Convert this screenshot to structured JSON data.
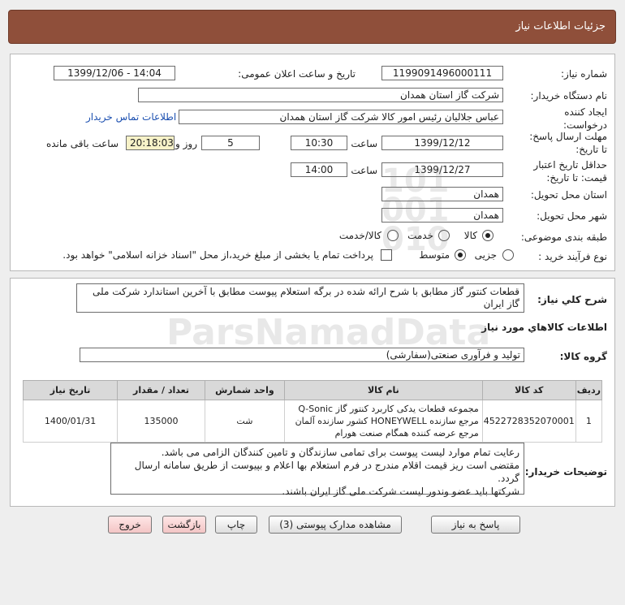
{
  "header": {
    "title": "جزئیات اطلاعات نیاز"
  },
  "fields": {
    "need_number_label": "شماره نیاز:",
    "need_number": "1199091496000111",
    "announce_label": "تاریخ و ساعت اعلان عمومی:",
    "announce_value": "1399/12/06 - 14:04",
    "buyer_label": "نام دستگاه خریدار:",
    "buyer_value": "شرکت گاز استان همدان",
    "creator_label": "ایجاد کننده درخواست:",
    "creator_value": "عباس جلالیان رئیس امور کالا شرکت گاز استان همدان",
    "contact_link": "اطلاعات تماس خریدار",
    "deadline_label_1": "مهلت ارسال پاسخ:",
    "deadline_label_2": "تا تاریخ:",
    "deadline_date": "1399/12/12",
    "time_label": "ساعت",
    "deadline_time": "10:30",
    "days_value": "5",
    "days_label": "روز و",
    "remaining_time": "20:18:03",
    "remaining_label": "ساعت باقی مانده",
    "validity_label_1": "حداقل تاریخ اعتبار",
    "validity_label_2": "قیمت: تا تاریخ:",
    "validity_date": "1399/12/27",
    "validity_time_label": "ساعت",
    "validity_time": "14:00",
    "province_label": "استان محل تحویل:",
    "province_value": "همدان",
    "city_label": "شهر محل تحویل:",
    "city_value": "همدان",
    "category_label": "طبقه بندی موضوعی:",
    "category_options": [
      "کالا",
      "خدمت",
      "کالا/خدمت"
    ],
    "process_label": "نوع فرآیند خرید :",
    "process_options": [
      "جزیی",
      "متوسط"
    ],
    "payment_note": "پرداخت تمام یا بخشی از مبلغ خرید،از محل \"اسناد خزانه اسلامی\" خواهد بود."
  },
  "description": {
    "label": "شرح کلي نياز:",
    "value": "قطعات کنتور گاز مطابق با شرح ارائه شده در برگه استعلام پیوست مطابق با آخرین استاندارد شرکت ملی گاز ایران"
  },
  "goods": {
    "section_title": "اطلاعات کالاهاي مورد نياز",
    "group_label": "گروه کالا:",
    "group_value": "تولید و فرآوری صنعتی(سفارشی)",
    "columns": [
      "ردیف",
      "کد کالا",
      "نام کالا",
      "واحد شمارش",
      "تعداد / مقدار",
      "تاریخ نیاز"
    ],
    "rows": [
      {
        "row": "1",
        "code": "4522728352070001",
        "name": "مجموعه قطعات یدکی کاربرد کنتور گاز Q-Sonic مرجع سازنده HONEYWELL کشور سازنده آلمان مرجع عرضه کننده همگام صنعت هورام",
        "unit": "شت",
        "qty": "135000",
        "date": "1400/01/31"
      }
    ]
  },
  "buyer_notes": {
    "label": "توضیحات خریدار:",
    "lines": [
      "رعایت تمام موارد لیست پیوست برای تمامی سازندگان و تامین کنندگان الزامی می باشد.",
      "مقتضی است ریز قیمت اقلام مندرج در فرم استعلام بها اعلام و بپیوست از طریق سامانه ارسال گردد.",
      "شرکتها باید عضو وندور لیست شرکت ملی گاز  ایران باشند."
    ]
  },
  "buttons": {
    "reply": "پاسخ به نیاز",
    "attachments": "مشاهده مدارک پیوستی (3)",
    "print": "چاپ",
    "back": "بازگشت",
    "exit": "خروج"
  },
  "colors": {
    "header_bg": "#8f4f3a",
    "link": "#1b4fb0",
    "remaining_bg": "#f7f2c8"
  }
}
